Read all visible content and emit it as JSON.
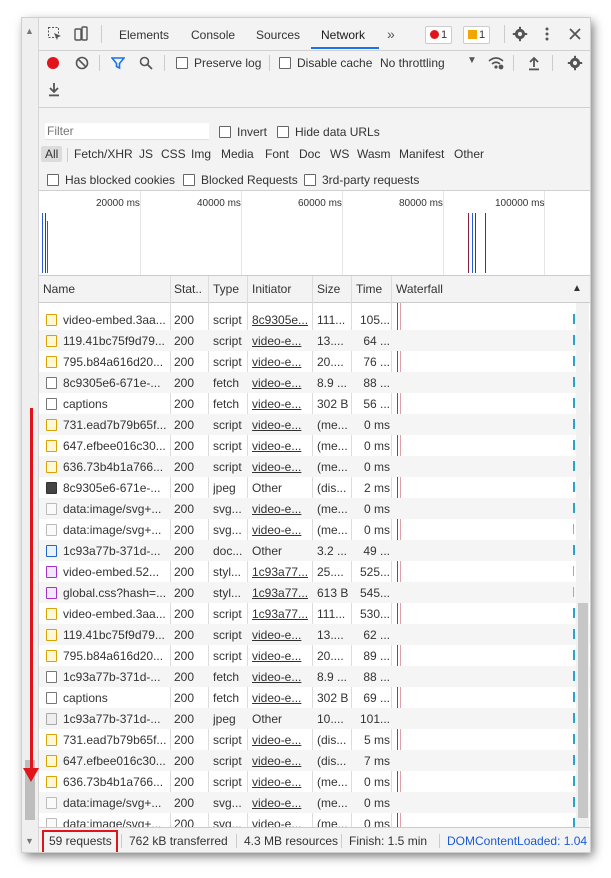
{
  "tabs": {
    "items": [
      "Elements",
      "Console",
      "Sources",
      "Network"
    ],
    "more": "»",
    "error_count": "1",
    "warning_count": "1"
  },
  "toolbar": {
    "preserve_log": "Preserve log",
    "disable_cache": "Disable cache",
    "throttling": "No throttling"
  },
  "filter": {
    "placeholder": "Filter",
    "invert": "Invert",
    "hide_data_urls": "Hide data URLs",
    "types": [
      "All",
      "Fetch/XHR",
      "JS",
      "CSS",
      "Img",
      "Media",
      "Font",
      "Doc",
      "WS",
      "Wasm",
      "Manifest",
      "Other"
    ],
    "has_blocked_cookies": "Has blocked cookies",
    "blocked_requests": "Blocked Requests",
    "third_party": "3rd-party requests"
  },
  "overview": {
    "ticks": [
      "20000 ms",
      "40000 ms",
      "60000 ms",
      "80000 ms",
      "100000 ms"
    ]
  },
  "columns": [
    "Name",
    "Stat..",
    "Type",
    "Initiator",
    "Size",
    "Time",
    "Waterfall"
  ],
  "rows": [
    {
      "icon": "script",
      "name": "video-embed.3aa...",
      "status": "200",
      "type": "script",
      "initiator": "8c9305e...",
      "init_link": true,
      "size": "111...",
      "time": "105..."
    },
    {
      "icon": "script",
      "name": "119.41bc75f9d79...",
      "status": "200",
      "type": "script",
      "initiator": "video-e...",
      "init_link": true,
      "size": "13....",
      "time": "64 ..."
    },
    {
      "icon": "script",
      "name": "795.b84a616d20...",
      "status": "200",
      "type": "script",
      "initiator": "video-e...",
      "init_link": true,
      "size": "20....",
      "time": "76 ..."
    },
    {
      "icon": "fetch",
      "name": "8c9305e6-671e-...",
      "status": "200",
      "type": "fetch",
      "initiator": "video-e...",
      "init_link": true,
      "size": "8.9 ...",
      "time": "88 ..."
    },
    {
      "icon": "fetch",
      "name": "captions",
      "status": "200",
      "type": "fetch",
      "initiator": "video-e...",
      "init_link": true,
      "size": "302 B",
      "time": "56 ..."
    },
    {
      "icon": "script",
      "name": "731.ead7b79b65f...",
      "status": "200",
      "type": "script",
      "initiator": "video-e...",
      "init_link": true,
      "size": "(me...",
      "time": "0 ms"
    },
    {
      "icon": "script",
      "name": "647.efbee016c30...",
      "status": "200",
      "type": "script",
      "initiator": "video-e...",
      "init_link": true,
      "size": "(me...",
      "time": "0 ms"
    },
    {
      "icon": "script",
      "name": "636.73b4b1a766...",
      "status": "200",
      "type": "script",
      "initiator": "video-e...",
      "init_link": true,
      "size": "(me...",
      "time": "0 ms"
    },
    {
      "icon": "jpeg",
      "name": "8c9305e6-671e-...",
      "status": "200",
      "type": "jpeg",
      "initiator": "Other",
      "init_link": false,
      "size": "(dis...",
      "time": "2 ms"
    },
    {
      "icon": "data",
      "name": "data:image/svg+...",
      "status": "200",
      "type": "svg...",
      "initiator": "video-e...",
      "init_link": true,
      "size": "(me...",
      "time": "0 ms"
    },
    {
      "icon": "data",
      "name": "data:image/svg+...",
      "status": "200",
      "type": "svg...",
      "initiator": "video-e...",
      "init_link": true,
      "size": "(me...",
      "time": "0 ms"
    },
    {
      "icon": "doc",
      "name": "1c93a77b-371d-...",
      "status": "200",
      "type": "doc...",
      "initiator": "Other",
      "init_link": false,
      "size": "3.2 ...",
      "time": "49 ..."
    },
    {
      "icon": "style",
      "name": "video-embed.52...",
      "status": "200",
      "type": "styl...",
      "initiator": "1c93a77...",
      "init_link": true,
      "size": "25....",
      "time": "525..."
    },
    {
      "icon": "style",
      "name": "global.css?hash=...",
      "status": "200",
      "type": "styl...",
      "initiator": "1c93a77...",
      "init_link": true,
      "size": "613 B",
      "time": "545..."
    },
    {
      "icon": "script",
      "name": "video-embed.3aa...",
      "status": "200",
      "type": "script",
      "initiator": "1c93a77...",
      "init_link": true,
      "size": "111...",
      "time": "530..."
    },
    {
      "icon": "script",
      "name": "119.41bc75f9d79...",
      "status": "200",
      "type": "script",
      "initiator": "video-e...",
      "init_link": true,
      "size": "13....",
      "time": "62 ..."
    },
    {
      "icon": "script",
      "name": "795.b84a616d20...",
      "status": "200",
      "type": "script",
      "initiator": "video-e...",
      "init_link": true,
      "size": "20....",
      "time": "89 ..."
    },
    {
      "icon": "fetch",
      "name": "1c93a77b-371d-...",
      "status": "200",
      "type": "fetch",
      "initiator": "video-e...",
      "init_link": true,
      "size": "8.9 ...",
      "time": "88 ..."
    },
    {
      "icon": "fetch",
      "name": "captions",
      "status": "200",
      "type": "fetch",
      "initiator": "video-e...",
      "init_link": true,
      "size": "302 B",
      "time": "69 ..."
    },
    {
      "icon": "img",
      "name": "1c93a77b-371d-...",
      "status": "200",
      "type": "jpeg",
      "initiator": "Other",
      "init_link": false,
      "size": "10....",
      "time": "101..."
    },
    {
      "icon": "script",
      "name": "731.ead7b79b65f...",
      "status": "200",
      "type": "script",
      "initiator": "video-e...",
      "init_link": true,
      "size": "(dis...",
      "time": "5 ms"
    },
    {
      "icon": "script",
      "name": "647.efbee016c30...",
      "status": "200",
      "type": "script",
      "initiator": "video-e...",
      "init_link": true,
      "size": "(dis...",
      "time": "7 ms"
    },
    {
      "icon": "script",
      "name": "636.73b4b1a766...",
      "status": "200",
      "type": "script",
      "initiator": "video-e...",
      "init_link": true,
      "size": "(me...",
      "time": "0 ms"
    },
    {
      "icon": "data",
      "name": "data:image/svg+...",
      "status": "200",
      "type": "svg...",
      "initiator": "video-e...",
      "init_link": true,
      "size": "(me...",
      "time": "0 ms"
    },
    {
      "icon": "data",
      "name": "data:image/svg+...",
      "status": "200",
      "type": "svg...",
      "initiator": "video-e...",
      "init_link": true,
      "size": "(me...",
      "time": "0 ms"
    }
  ],
  "status": {
    "requests": "59 requests",
    "transferred": "762 kB transferred",
    "resources": "4.3 MB resources",
    "finish": "Finish: 1.5 min",
    "dom_content_loaded": "DOMContentLoaded: 1.04"
  },
  "colors": {
    "accent": "#1a73e8",
    "record": "#e0141a",
    "annotation": "#e0141a",
    "link_blue": "#1a5ad6"
  }
}
